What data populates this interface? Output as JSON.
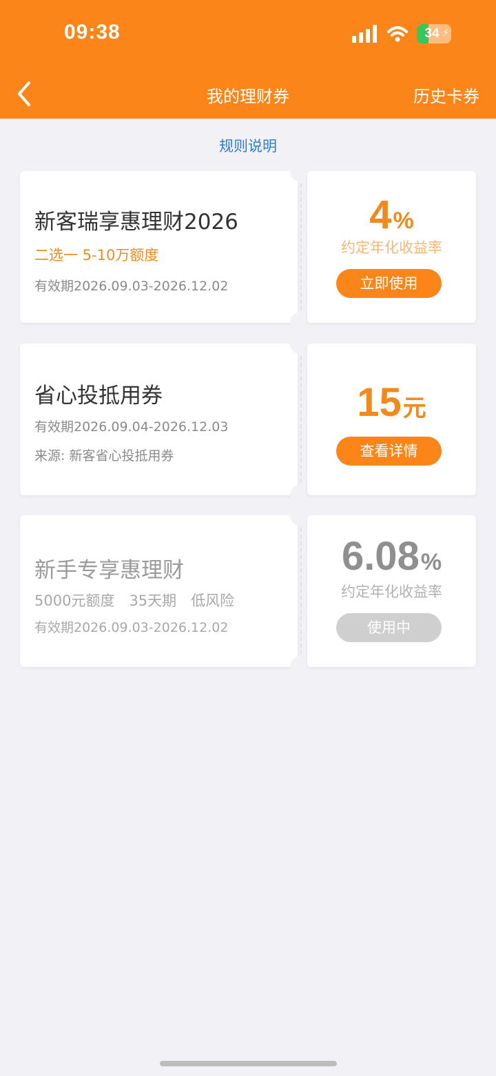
{
  "status_bar": {
    "time": "09:38",
    "battery": "34"
  },
  "nav": {
    "title": "我的理财券",
    "right_action": "历史卡券"
  },
  "rules_link": "规则说明",
  "coupons": [
    {
      "title": "新客瑞享惠理财2026",
      "highlight": "二选一 5-10万额度",
      "validity": "有效期2026.09.03-2026.12.02",
      "value": "4",
      "unit": "%",
      "value_label": "约定年化收益率",
      "button": "立即使用"
    },
    {
      "title": "省心投抵用券",
      "validity": "有效期2026.09.04-2026.12.03",
      "source": "来源: 新客省心投抵用券",
      "value": "15",
      "unit": "元",
      "button": "查看详情"
    },
    {
      "title": "新手专享惠理财",
      "details": "5000元额度　35天期　低风险",
      "validity": "有效期2026.09.03-2026.12.02",
      "value": "6.08",
      "unit": "%",
      "value_label": "约定年化收益率",
      "button": "使用中"
    }
  ],
  "colors": {
    "brand_orange": "#fb8518",
    "background": "#f2f2f6",
    "link_blue": "#2b7bd0",
    "disabled_grey": "#cfcfcf"
  }
}
